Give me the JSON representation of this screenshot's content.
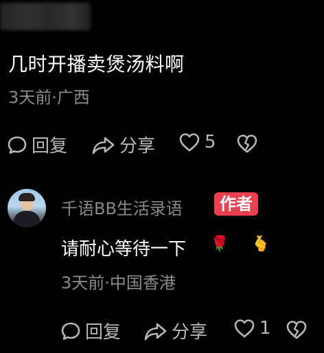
{
  "top_comment": {
    "text": "几时开播卖煲汤料啊",
    "meta": "3天前·广西",
    "actions": {
      "reply_label": "回复",
      "share_label": "分享",
      "like_count": "5"
    }
  },
  "reply": {
    "username": "千语BB生活录语",
    "author_badge": "作者",
    "text": "请耐心等待一下",
    "emoji_icons": [
      "rose-icon",
      "finger-heart-icon"
    ],
    "meta": "3天前·中国香港",
    "actions": {
      "reply_label": "回复",
      "share_label": "分享",
      "like_count": "1"
    }
  },
  "colors": {
    "background": "#000000",
    "primary_text": "#ffffff",
    "secondary_text": "#8a8a8a",
    "author_badge": "#e8404f"
  }
}
